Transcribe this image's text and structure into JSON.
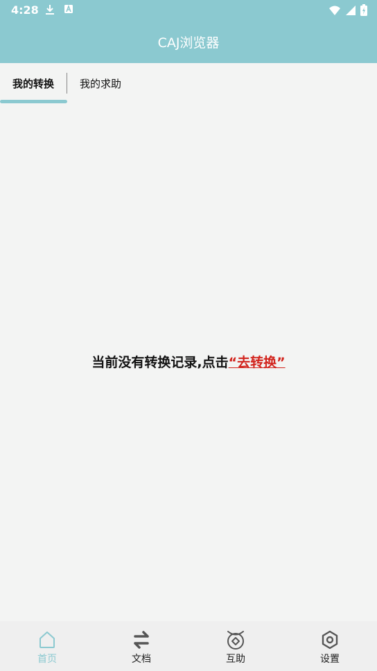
{
  "status": {
    "time": "4:28"
  },
  "app": {
    "title": "CAJ浏览器"
  },
  "tabs": [
    {
      "label": "我的转换",
      "active": true
    },
    {
      "label": "我的求助",
      "active": false
    }
  ],
  "empty": {
    "message": "当前没有转换记录,点击",
    "link": "“去转换”"
  },
  "bottom_nav": [
    {
      "label": "首页",
      "icon": "home-icon",
      "active": true
    },
    {
      "label": "文档",
      "icon": "swap-arrows-icon",
      "active": false
    },
    {
      "label": "互助",
      "icon": "mutual-help-icon",
      "active": false
    },
    {
      "label": "设置",
      "icon": "settings-hexagon-icon",
      "active": false
    }
  ],
  "colors": {
    "primary": "#8bc9d0",
    "background": "#f3f4f3",
    "link": "#d2231c"
  }
}
